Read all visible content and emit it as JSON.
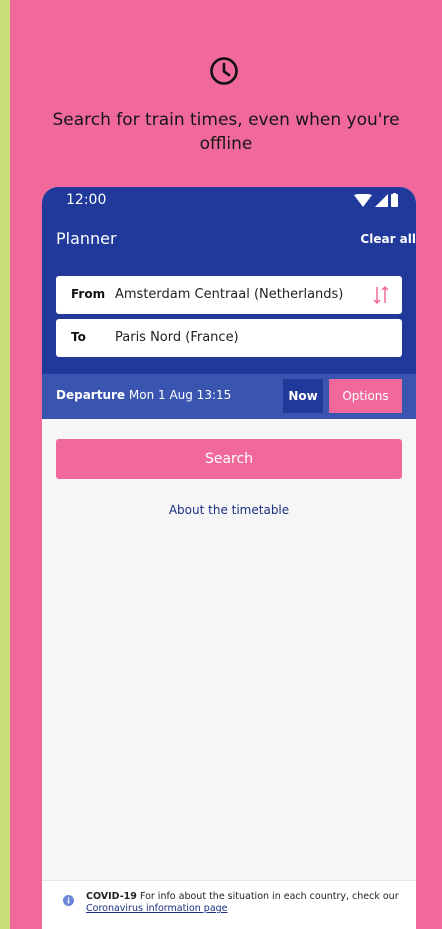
{
  "headline": "Search for train times, even when you're offline",
  "status": {
    "time": "12:00"
  },
  "header": {
    "title": "Planner",
    "clear_all": "Clear all"
  },
  "from": {
    "label": "From",
    "value": "Amsterdam Centraal (Netherlands)"
  },
  "to": {
    "label": "To",
    "value": "Paris Nord (France)"
  },
  "departure": {
    "label": "Departure",
    "value": "Mon 1 Aug 13:15",
    "now": "Now",
    "options": "Options"
  },
  "search_label": "Search",
  "about_link": "About the timetable",
  "covid": {
    "title": "COVID-19",
    "text": "For info about the situation in each country, check our",
    "link": "Coronavirus information page"
  },
  "colors": {
    "accent": "#f0699a",
    "primary": "#20399a",
    "bar": "#3a55b0"
  }
}
